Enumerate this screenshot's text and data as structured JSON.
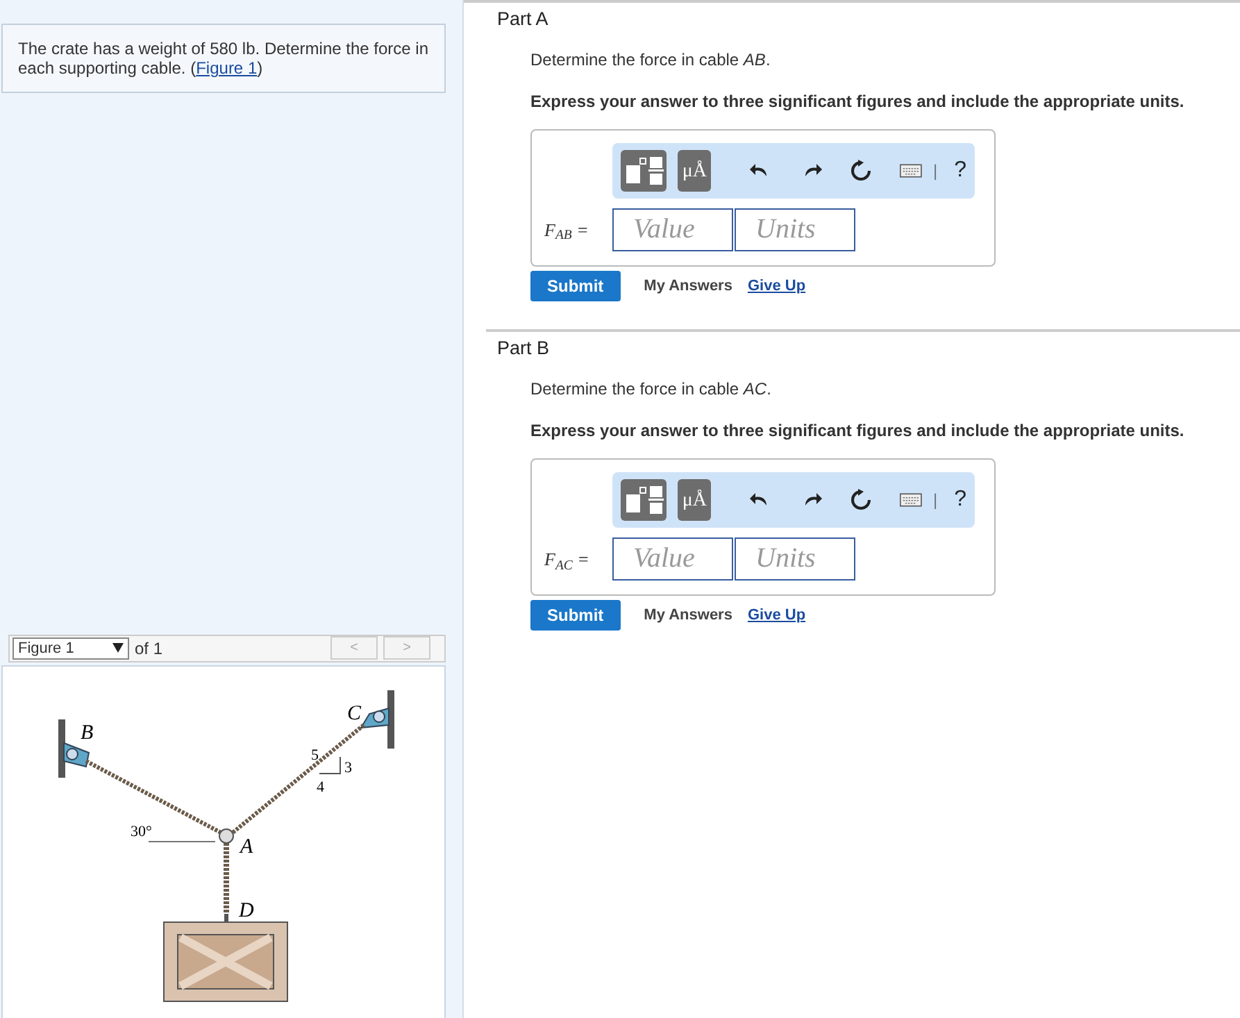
{
  "problem": {
    "text": "The crate has a weight of 580 lb. Determine the force in each supporting cable. (",
    "link": "Figure 1",
    "text_end": ")"
  },
  "figure": {
    "selector": "Figure 1",
    "of": "of 1",
    "prev": "<",
    "next": ">",
    "labels": {
      "b": "B",
      "c": "C",
      "a": "A",
      "d": "D",
      "angle": "30°",
      "hyp": "5",
      "rise": "3",
      "run": "4"
    }
  },
  "parts": [
    {
      "title": "Part A",
      "question": "Determine the force in cable *AB*.",
      "instruction": "Express your answer to three significant figures and include the appropriate units.",
      "units_tool": "μÅ",
      "keyboard_sep": "|",
      "help": "?",
      "label": "F$_{AB}$ =",
      "value_placeholder": "Value",
      "units_placeholder": "Units",
      "submit": "Submit",
      "my_answers": "My Answers",
      "give_up": "Give Up"
    },
    {
      "title": "Part B",
      "question": "Determine the force in cable *AC*.",
      "instruction": "Express your answer to three significant figures and include the appropriate units.",
      "units_tool": "μÅ",
      "keyboard_sep": "|",
      "help": "?",
      "label": "F$_{AC}$ =",
      "value_placeholder": "Value",
      "units_placeholder": "Units",
      "submit": "Submit",
      "my_answers": "My Answers",
      "give_up": "Give Up"
    }
  ]
}
